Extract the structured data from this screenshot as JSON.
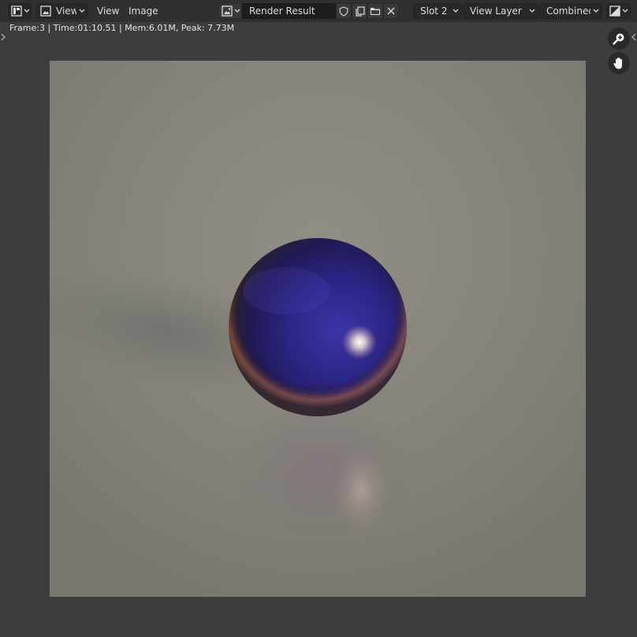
{
  "header": {
    "editor_type_icon": "image-editor-icon",
    "view_menu": "View",
    "view_plain": "View",
    "image_menu": "Image",
    "image_browse_icon": "image-browse-icon",
    "image_name": "Render Result",
    "slot": "Slot 2",
    "view_layer": "View Layer",
    "pass": "Combined",
    "display_channels_icon": "display-channels-icon",
    "fake_user_icon": "shield-icon",
    "new_image_icon": "duplicate-icon",
    "open_image_icon": "folder-icon",
    "unlink_icon": "close-icon"
  },
  "info": {
    "text": "Frame:3 | Time:01:10.51 | Mem:6.01M, Peak: 7.73M"
  },
  "navigation": {
    "zoom_icon": "zoom-icon",
    "pan_icon": "hand-icon"
  },
  "render": {
    "description_icon": "render-image"
  },
  "colors": {
    "background": "#3d3d3d",
    "header": "#303030",
    "sphere": "#2e2a7a",
    "floor": "#85827a"
  }
}
